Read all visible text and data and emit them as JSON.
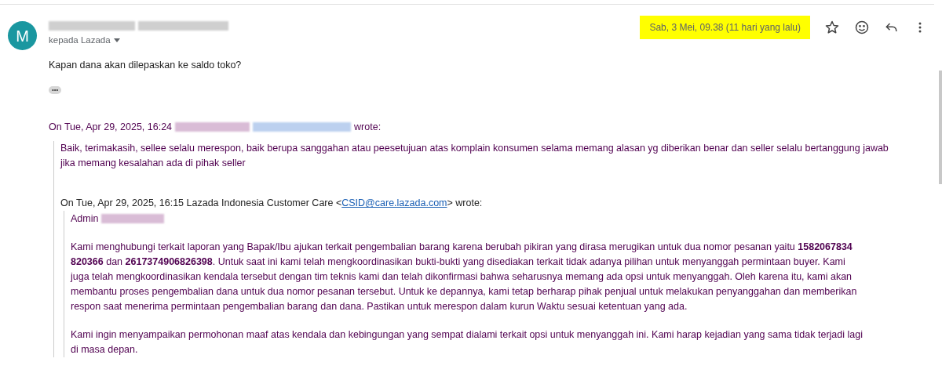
{
  "message": {
    "avatar_letter": "M",
    "recipient": "kepada Lazada",
    "date": "Sab, 3 Mei, 09.38 (11 hari yang lalu)",
    "starred": false,
    "body": "Kapan dana akan dilepaskan ke saldo toko?",
    "trim_toggle": "•••"
  },
  "quote": {
    "header_prefix": "On Tue, Apr 29, 2025, 16:24",
    "header_suffix": "wrote:",
    "paragraphs": [
      "Baik, terimakasih, sellee selalu merespon, baik berupa sanggahan  atau peesetujuan atas komplain konsumen selama memang alasan yg diberikan benar dan seller selalu bertanggung jawab jika memang kesalahan ada di pihak seller"
    ],
    "nested": {
      "header_prefix": "On Tue, Apr 29, 2025, 16:15 Lazada Indonesia Customer Care <",
      "email": "CSID@care.lazada.com",
      "header_suffix": "> wrote:",
      "greeting": "Admin",
      "paragraphs": [
        "Kami menghubungi terkait laporan yang Bapak/Ibu ajukan terkait pengembalian barang karena berubah pikiran yang dirasa merugikan untuk dua nomor pesanan yaitu **1582067834 820366** dan **2617374906826398**. Untuk saat ini kami telah mengkoordinasikan bukti-bukti yang disediakan terkait tidak adanya pilihan untuk menyanggah permintaan buyer. Kami juga telah mengkoordinasikan kendala tersebut dengan tim teknis kami dan telah dikonfirmasi bahwa seharusnya memang ada opsi untuk menyanggah. Oleh karena itu, kami akan membantu proses pengembalian dana untuk dua nomor pesanan tersebut. Untuk ke depannya, kami tetap berharap pihak penjual untuk melakukan penyanggahan dan memberikan respon saat menerima permintaan pengembalian barang dan dana. Pastikan untuk merespon dalam kurun Waktu sesuai ketentuan yang ada.",
        "Kami ingin menyampaikan permohonan maaf atas kendala dan kebingungan yang sempat dialami terkait opsi untuk menyanggah ini. Kami harap kejadian yang sama tidak terjadi lagi di masa depan."
      ]
    }
  }
}
